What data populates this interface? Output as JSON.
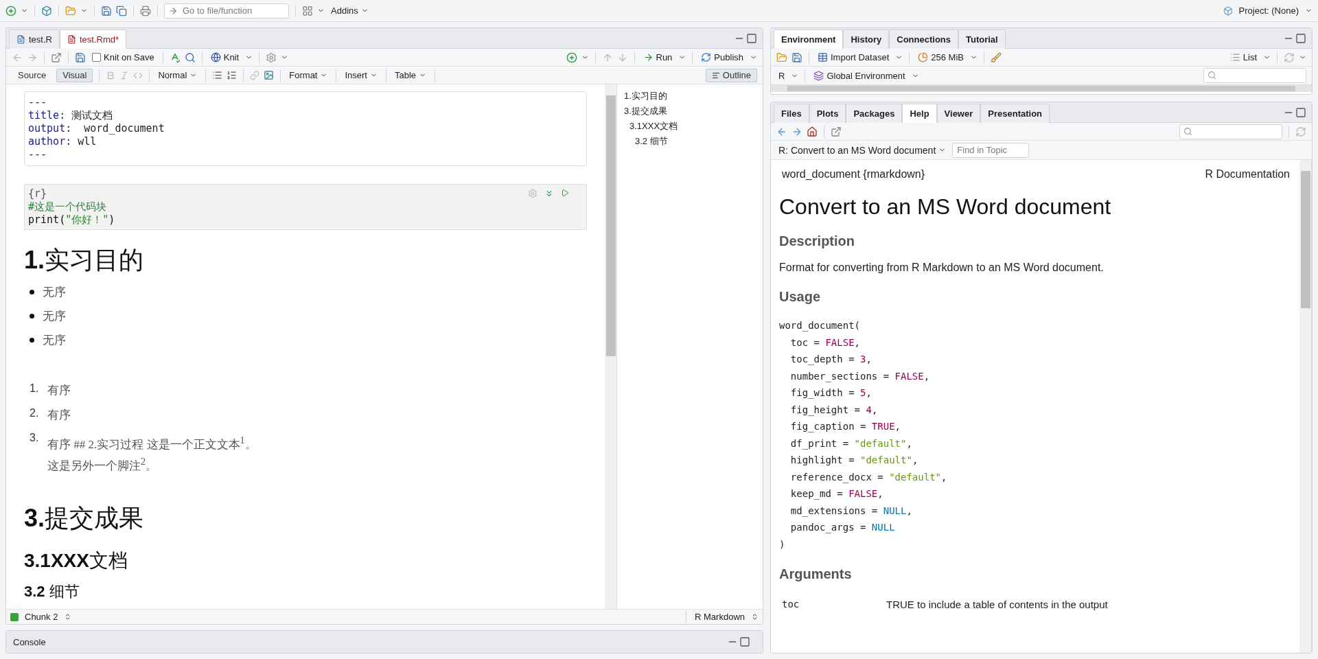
{
  "main_toolbar": {
    "goto_placeholder": "Go to file/function",
    "addins": "Addins",
    "project": "Project: (None)"
  },
  "editor": {
    "tabs": [
      {
        "label": "test.R",
        "selected": false,
        "modified": false
      },
      {
        "label": "test.Rmd*",
        "selected": true,
        "modified": true
      }
    ],
    "knit_on_save": {
      "label": "Knit on Save",
      "checked": false
    },
    "knit": "Knit",
    "run": "Run",
    "publish": "Publish",
    "modes": [
      {
        "label": "Source",
        "selected": false
      },
      {
        "label": "Visual",
        "selected": true
      }
    ],
    "style": "Normal",
    "menus": [
      "Format",
      "Insert",
      "Table"
    ],
    "outline_button": "Outline",
    "yaml": [
      {
        "key": "---"
      },
      {
        "key": "title:",
        "value": " 测试文档"
      },
      {
        "key": "output:",
        "value": "  word_document"
      },
      {
        "key": "author:",
        "value": " wll"
      },
      {
        "key": "---"
      }
    ],
    "chunk": [
      [
        {
          "t": "{r}",
          "kind": "delim"
        }
      ],
      [
        {
          "t": "#这是一个代码块",
          "kind": "comment"
        }
      ],
      [
        {
          "t": "print(",
          "kind": "plain"
        },
        {
          "t": "\"你好！\"",
          "kind": "string"
        },
        {
          "t": ")",
          "kind": "plain"
        }
      ]
    ],
    "blocks": [
      {
        "kind": "h1",
        "text": "**1.**实习目的"
      },
      {
        "kind": "bullets",
        "items": [
          "无序",
          "无序",
          "无序"
        ]
      },
      {
        "kind": "ordered",
        "items": [
          {
            "number": "1.",
            "lines": [
              "有序"
            ]
          },
          {
            "number": "2.",
            "lines": [
              "有序"
            ]
          },
          {
            "number": "3.",
            "lines": [
              "有序 ## 2.实习过程 这是一个正文文本$^{1}$。",
              "这是另外一个脚注$^{2}$。"
            ]
          }
        ]
      },
      {
        "kind": "h1",
        "text": "**3.**提交成果"
      },
      {
        "kind": "h2",
        "text": "**3.1XXX**文档"
      },
      {
        "kind": "h3",
        "text": "**3.2** 细节"
      }
    ],
    "outline": [
      {
        "label": "1.实习目的"
      },
      {
        "label": "3.提交成果",
        "children": [
          {
            "label": "3.1XXX文档",
            "children": [
              {
                "label": "3.2 细节"
              }
            ]
          }
        ]
      }
    ],
    "status_chunk": "Chunk 2",
    "status_mode": "R Markdown"
  },
  "console": {
    "title": "Console"
  },
  "environment": {
    "tabs": [
      {
        "label": "Environment",
        "selected": true
      },
      {
        "label": "History",
        "selected": false
      },
      {
        "label": "Connections",
        "selected": false
      },
      {
        "label": "Tutorial",
        "selected": false
      }
    ],
    "import": "Import Dataset",
    "memory": "256 MiB",
    "view": "List",
    "language": "R",
    "scope": "Global Environment"
  },
  "files": {
    "tabs": [
      {
        "label": "Files",
        "selected": false
      },
      {
        "label": "Plots",
        "selected": false
      },
      {
        "label": "Packages",
        "selected": false
      },
      {
        "label": "Help",
        "selected": true
      },
      {
        "label": "Viewer",
        "selected": false
      },
      {
        "label": "Presentation",
        "selected": false
      }
    ],
    "topic": "R: Convert to an MS Word document",
    "find_placeholder": "Find in Topic"
  },
  "help": {
    "package": "word_document {rmarkdown}",
    "source": "R Documentation",
    "title": "Convert to an MS Word document",
    "description_heading": "Description",
    "description": "Format for converting from R Markdown to an MS Word document.",
    "usage_heading": "Usage",
    "usage": [
      [
        {
          "t": "word_document(",
          "kind": "plain"
        }
      ],
      [
        {
          "t": "  toc = ",
          "kind": "plain"
        },
        {
          "t": "FALSE",
          "kind": "logical"
        },
        {
          "t": ",",
          "kind": "plain"
        }
      ],
      [
        {
          "t": "  toc_depth = ",
          "kind": "plain"
        },
        {
          "t": "3",
          "kind": "number"
        },
        {
          "t": ",",
          "kind": "plain"
        }
      ],
      [
        {
          "t": "  number_sections = ",
          "kind": "plain"
        },
        {
          "t": "FALSE",
          "kind": "logical"
        },
        {
          "t": ",",
          "kind": "plain"
        }
      ],
      [
        {
          "t": "  fig_width = ",
          "kind": "plain"
        },
        {
          "t": "5",
          "kind": "number"
        },
        {
          "t": ",",
          "kind": "plain"
        }
      ],
      [
        {
          "t": "  fig_height = ",
          "kind": "plain"
        },
        {
          "t": "4",
          "kind": "number"
        },
        {
          "t": ",",
          "kind": "plain"
        }
      ],
      [
        {
          "t": "  fig_caption = ",
          "kind": "plain"
        },
        {
          "t": "TRUE",
          "kind": "logical"
        },
        {
          "t": ",",
          "kind": "plain"
        }
      ],
      [
        {
          "t": "  df_print = ",
          "kind": "plain"
        },
        {
          "t": "\"default\"",
          "kind": "string"
        },
        {
          "t": ",",
          "kind": "plain"
        }
      ],
      [
        {
          "t": "  highlight = ",
          "kind": "plain"
        },
        {
          "t": "\"default\"",
          "kind": "string"
        },
        {
          "t": ",",
          "kind": "plain"
        }
      ],
      [
        {
          "t": "  reference_docx = ",
          "kind": "plain"
        },
        {
          "t": "\"default\"",
          "kind": "string"
        },
        {
          "t": ",",
          "kind": "plain"
        }
      ],
      [
        {
          "t": "  keep_md = ",
          "kind": "plain"
        },
        {
          "t": "FALSE",
          "kind": "logical"
        },
        {
          "t": ",",
          "kind": "plain"
        }
      ],
      [
        {
          "t": "  md_extensions = ",
          "kind": "plain"
        },
        {
          "t": "NULL",
          "kind": "null"
        },
        {
          "t": ",",
          "kind": "plain"
        }
      ],
      [
        {
          "t": "  pandoc_args = ",
          "kind": "plain"
        },
        {
          "t": "NULL",
          "kind": "null"
        }
      ],
      [
        {
          "t": ")",
          "kind": "plain"
        }
      ]
    ],
    "arguments_heading": "Arguments",
    "argument_rows": [
      {
        "name": "toc",
        "text": "TRUE to include a table of contents in the output"
      }
    ]
  }
}
